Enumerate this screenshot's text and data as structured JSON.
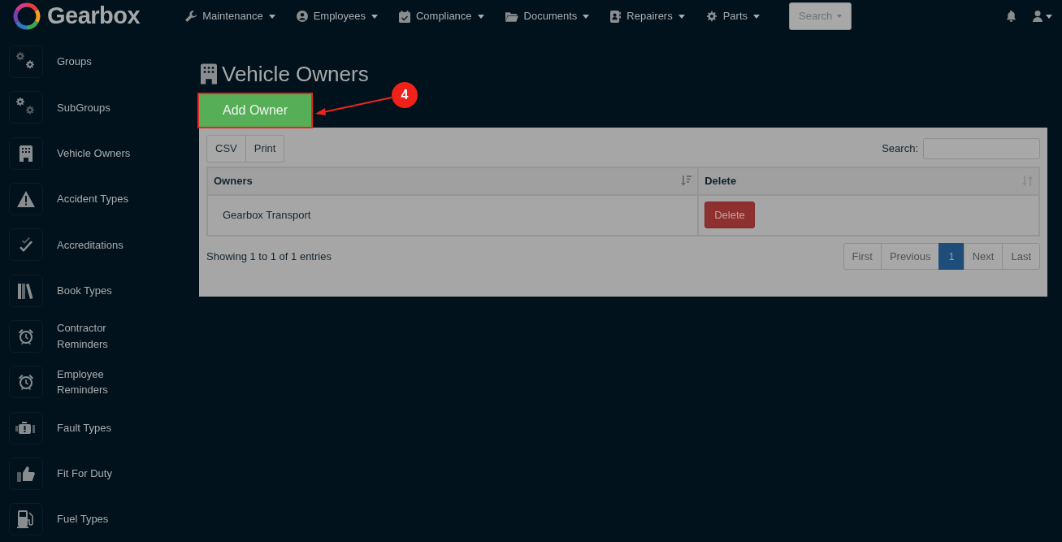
{
  "brand": {
    "name": "Gearbox"
  },
  "nav_menus": [
    {
      "label": "Maintenance"
    },
    {
      "label": "Employees"
    },
    {
      "label": "Compliance"
    },
    {
      "label": "Documents"
    },
    {
      "label": "Repairers"
    },
    {
      "label": "Parts"
    }
  ],
  "search_button": {
    "label": "Search"
  },
  "sidebar": {
    "items": [
      {
        "label": "Groups"
      },
      {
        "label": "SubGroups"
      },
      {
        "label": "Vehicle Owners"
      },
      {
        "label": "Accident Types"
      },
      {
        "label": "Accreditations"
      },
      {
        "label": "Book Types"
      },
      {
        "label": "Contractor Reminders"
      },
      {
        "label": "Employee Reminders"
      },
      {
        "label": "Fault Types"
      },
      {
        "label": "Fit For Duty"
      },
      {
        "label": "Fuel Types"
      }
    ]
  },
  "page": {
    "title": "Vehicle Owners",
    "add_button": {
      "label": "Add Owner",
      "highlighted": true
    },
    "callout": {
      "number": "4"
    }
  },
  "table": {
    "export_buttons": [
      "CSV",
      "Print"
    ],
    "search_label": "Search:",
    "columns": [
      {
        "label": "Owners",
        "sorted": true
      },
      {
        "label": "Delete",
        "sorted": false
      }
    ],
    "rows": [
      {
        "owner": "Gearbox Transport",
        "action": "Delete"
      }
    ],
    "info": "Showing 1 to 1 of 1 entries",
    "pagination": [
      {
        "label": "First",
        "selected": false
      },
      {
        "label": "Previous",
        "selected": false
      },
      {
        "label": "1",
        "selected": true
      },
      {
        "label": "Next",
        "selected": false
      },
      {
        "label": "Last",
        "selected": false
      }
    ]
  }
}
